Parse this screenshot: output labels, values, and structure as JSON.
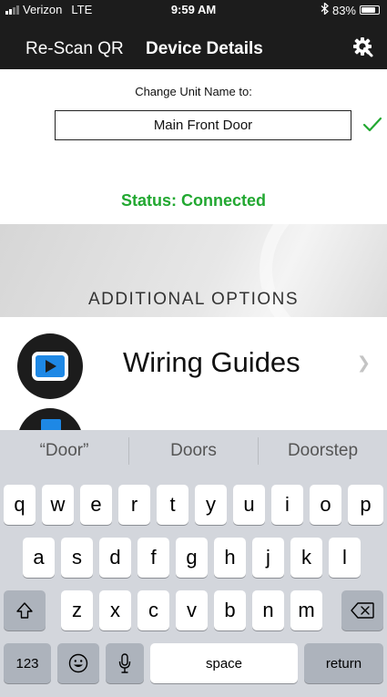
{
  "status_bar": {
    "carrier": "Verizon",
    "network": "LTE",
    "time": "9:59 AM",
    "bluetooth_icon": "bluetooth-icon",
    "battery_percent": "83%",
    "battery_level": 0.83
  },
  "nav": {
    "back_label": "Re-Scan QR",
    "title": "Device Details",
    "settings_icon": "gear-icon"
  },
  "unit_name": {
    "label": "Change Unit Name to:",
    "value": "Main Front Door",
    "confirm_icon": "checkmark-icon"
  },
  "status_text": "Status: Connected",
  "additional_options": {
    "heading": "ADDITIONAL OPTIONS",
    "items": [
      {
        "label": "Wiring Guides",
        "icon": "video-play-icon"
      },
      {
        "label": "",
        "icon": "document-icon"
      }
    ]
  },
  "keyboard": {
    "suggestions": [
      "“Door”",
      "Doors",
      "Doorstep"
    ],
    "row1": [
      "q",
      "w",
      "e",
      "r",
      "t",
      "y",
      "u",
      "i",
      "o",
      "p"
    ],
    "row2": [
      "a",
      "s",
      "d",
      "f",
      "g",
      "h",
      "j",
      "k",
      "l"
    ],
    "row3": [
      "z",
      "x",
      "c",
      "v",
      "b",
      "n",
      "m"
    ],
    "numbers_key": "123",
    "space_key": "space",
    "return_key": "return"
  },
  "colors": {
    "nav_background": "#1c1c1c",
    "status_green": "#22a831",
    "accent_blue": "#1e88e5",
    "keyboard_background": "#d3d6dc"
  }
}
